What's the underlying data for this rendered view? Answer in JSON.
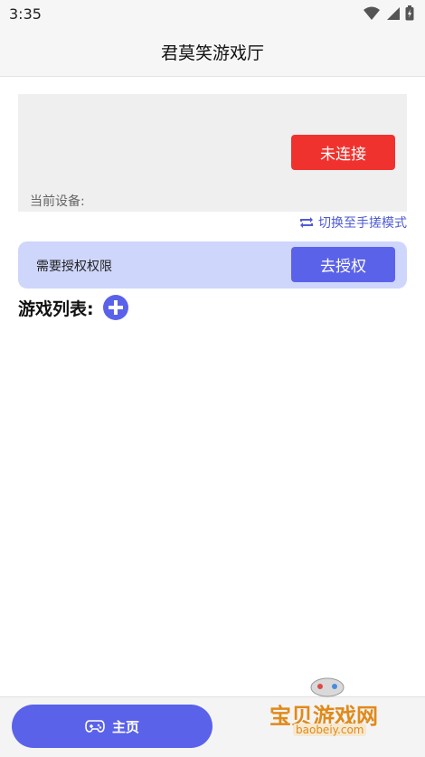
{
  "status_bar": {
    "time": "3:35"
  },
  "app_bar": {
    "title": "君莫笑游戏厅"
  },
  "device_card": {
    "connect_label": "未连接",
    "current_device_label": "当前设备:"
  },
  "switch_mode": {
    "label": "切换至手搓模式"
  },
  "auth_banner": {
    "message": "需要授权权限",
    "button_label": "去授权"
  },
  "game_list": {
    "title": "游戏列表:"
  },
  "bottom_nav": {
    "home_label": "主页"
  },
  "watermark": {
    "brand": "宝贝游戏网",
    "site": "baobeiy.com"
  },
  "colors": {
    "connect_red": "#f0322e",
    "accent_blue": "#5a62ea",
    "auth_banner_bg": "#cfd6fb"
  }
}
